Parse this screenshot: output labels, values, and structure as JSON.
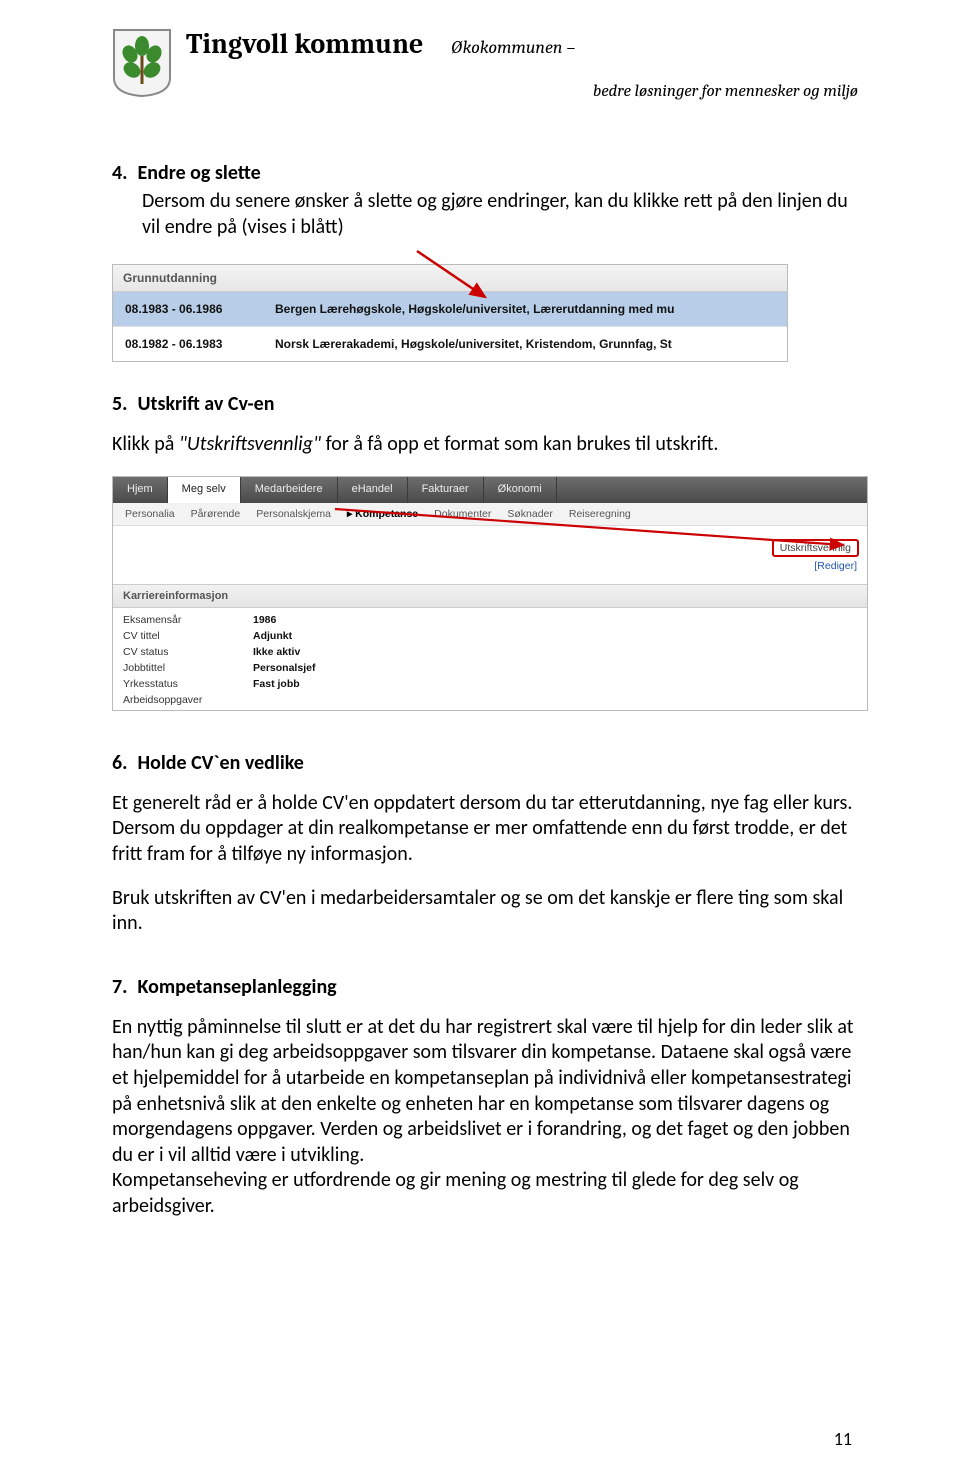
{
  "header": {
    "org": "Tingvoll kommune",
    "tag1": "Økokommunen –",
    "tag2": "bedre løsninger for mennesker og miljø"
  },
  "sections": {
    "s4": {
      "num": "4.",
      "title": "Endre og slette",
      "body": "Dersom du senere ønsker å slette og gjøre endringer, kan du klikke rett på den linjen du vil endre på (vises i blått)"
    },
    "s5": {
      "num": "5.",
      "title": "Utskrift av Cv-en",
      "body_pre": "Klikk på ",
      "body_em": "\"Utskriftsvennlig\"",
      "body_post": " for å få opp et format som kan brukes til utskrift."
    },
    "s6": {
      "num": "6.",
      "title": "Holde CV`en vedlike",
      "p1": "Et generelt råd er å holde CV'en oppdatert dersom du tar etterutdanning, nye fag eller kurs. Dersom du oppdager at din realkompetanse er mer omfattende enn du først trodde,  er det fritt fram for å tilføye ny informasjon.",
      "p2": "Bruk utskriften av CV'en i medarbeidersamtaler og se om det kanskje er flere ting som skal inn."
    },
    "s7": {
      "num": "7.",
      "title": "Kompetanseplanlegging",
      "p1": "En nyttig påminnelse til slutt er at det du har registrert skal være til hjelp for din leder slik at han/hun kan gi deg arbeidsoppgaver som tilsvarer din kompetanse. Dataene skal også være et hjelpemiddel for å utarbeide en kompetanseplan på individnivå eller kompetansestrategi på enhetsnivå slik at den enkelte og enheten har en kompetanse som tilsvarer dagens og morgendagens oppgaver. Verden og arbeidslivet er i forandring, og det faget og den jobben du er i vil alltid være i utvikling.",
      "p2": "Kompetanseheving er utfordrende og gir mening og mestring til glede for deg selv og arbeidsgiver."
    }
  },
  "shot1": {
    "header": "Grunnutdanning",
    "rows": [
      {
        "c1": "08.1983 - 06.1986",
        "c2": "Bergen Lærehøgskole, Høgskole/universitet, Lærerutdanning med mu"
      },
      {
        "c1": "08.1982 - 06.1983",
        "c2": "Norsk Lærerakademi, Høgskole/universitet, Kristendom, Grunnfag, St"
      }
    ]
  },
  "shot2": {
    "nav1": [
      "Hjem",
      "Meg selv",
      "Medarbeidere",
      "eHandel",
      "Fakturaer",
      "Økonomi"
    ],
    "nav1_active": "Meg selv",
    "nav2": [
      "Personalia",
      "Pårørende",
      "Personalskjema",
      "▸ Kompetanse",
      "Dokumenter",
      "Søknader",
      "Reiseregning"
    ],
    "nav2_active": "▸ Kompetanse",
    "utskrift": "Utskriftsvennlig",
    "rediger": "[Rediger]",
    "section": "Karriereinformasjon",
    "kv": [
      {
        "k": "Eksamensår",
        "v": "1986"
      },
      {
        "k": "CV tittel",
        "v": "Adjunkt"
      },
      {
        "k": "CV status",
        "v": "Ikke aktiv"
      },
      {
        "k": "Jobbtittel",
        "v": "Personalsjef"
      },
      {
        "k": "Yrkesstatus",
        "v": "Fast jobb"
      },
      {
        "k": "Arbeidsoppgaver",
        "v": ""
      }
    ]
  },
  "page_num": "11"
}
